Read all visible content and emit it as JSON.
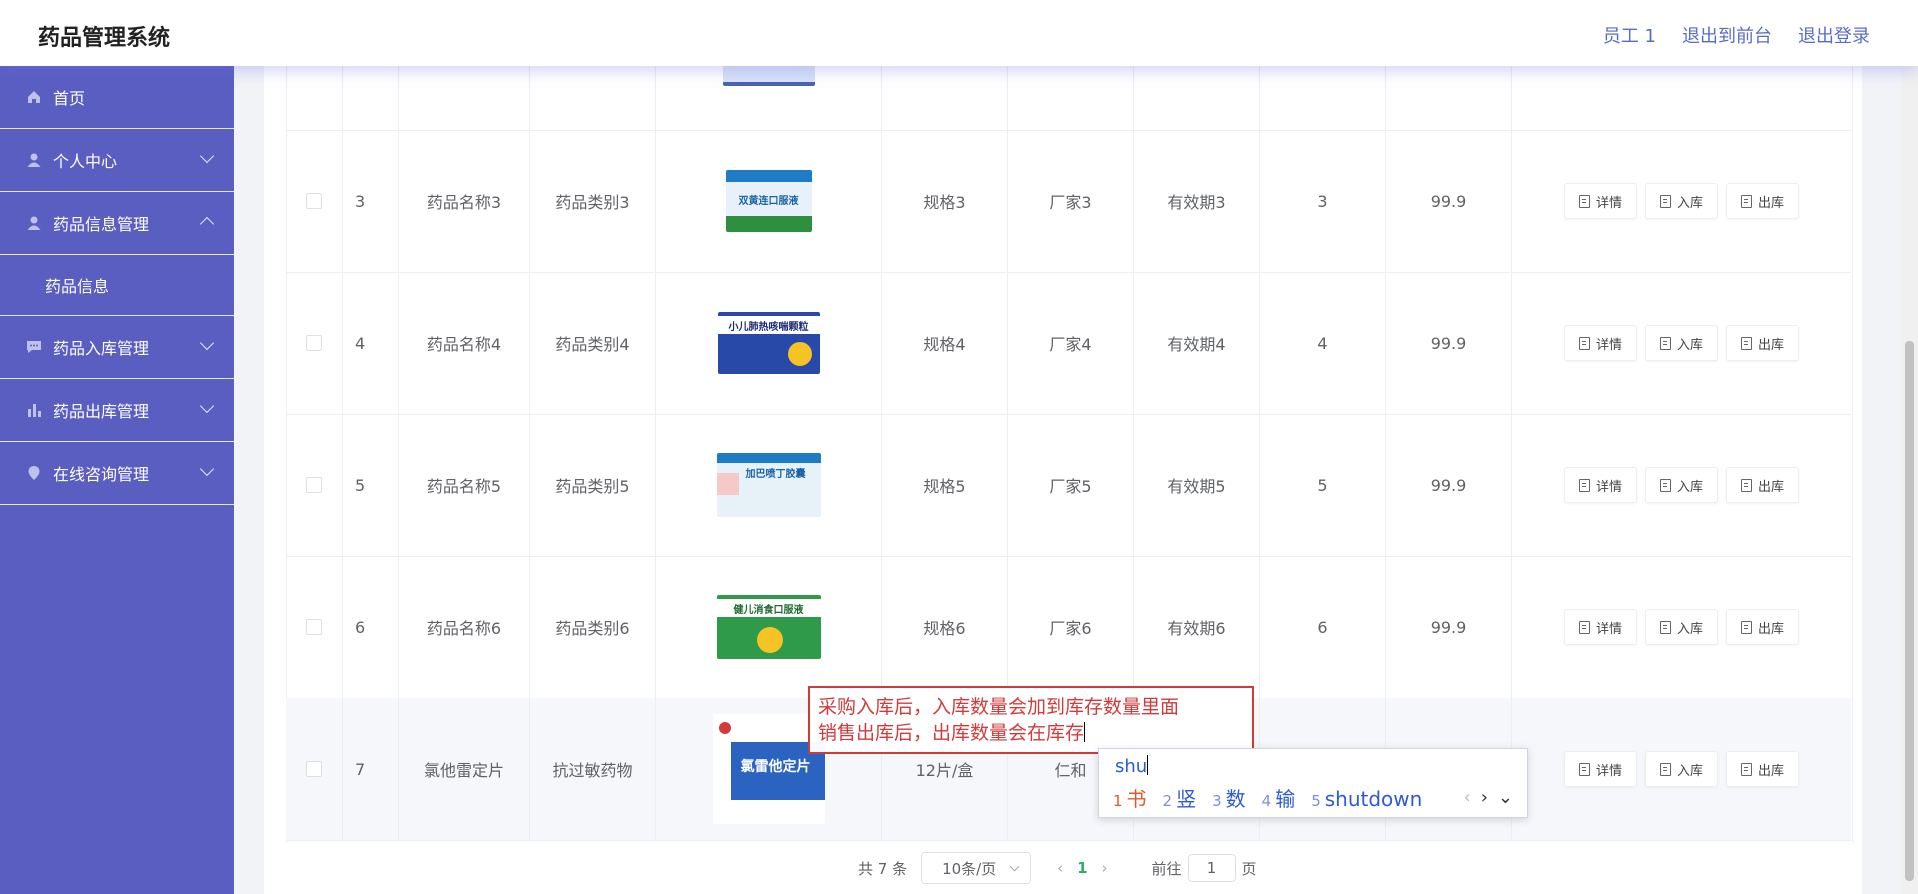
{
  "header": {
    "title": "药品管理系统",
    "links": [
      "员工 1",
      "退出到前台",
      "退出登录"
    ]
  },
  "sidebar": {
    "items": [
      {
        "label": "首页",
        "icon": "home-icon"
      },
      {
        "label": "个人中心",
        "icon": "user-icon"
      },
      {
        "label": "药品信息管理",
        "icon": "user-icon"
      },
      {
        "label": "药品信息"
      },
      {
        "label": "药品入库管理",
        "icon": "chat-icon"
      },
      {
        "label": "药品出库管理",
        "icon": "bar-chart-icon"
      },
      {
        "label": "在线咨询管理",
        "icon": "location-icon"
      }
    ]
  },
  "table": {
    "actions": {
      "detail": "详情",
      "stock_in": "入库",
      "stock_out": "出库"
    },
    "rows": [
      {
        "no": "3",
        "name": "药品名称3",
        "category": "药品类别3",
        "spec": "规格3",
        "maker": "厂家3",
        "expiry": "有效期3",
        "qty": "3",
        "price": "99.9",
        "image_label": "双黄连口服液"
      },
      {
        "no": "4",
        "name": "药品名称4",
        "category": "药品类别4",
        "spec": "规格4",
        "maker": "厂家4",
        "expiry": "有效期4",
        "qty": "4",
        "price": "99.9",
        "image_label": "小儿肺热咳喘颗粒"
      },
      {
        "no": "5",
        "name": "药品名称5",
        "category": "药品类别5",
        "spec": "规格5",
        "maker": "厂家5",
        "expiry": "有效期5",
        "qty": "5",
        "price": "99.9",
        "image_label": "加巴喷丁胶囊"
      },
      {
        "no": "6",
        "name": "药品名称6",
        "category": "药品类别6",
        "spec": "规格6",
        "maker": "厂家6",
        "expiry": "有效期6",
        "qty": "6",
        "price": "99.9",
        "image_label": "健儿消食口服液"
      },
      {
        "no": "7",
        "name": "氯他雷定片",
        "category": "抗过敏药物",
        "spec": "12片/盒",
        "maker": "仁和",
        "expiry": "",
        "qty": "",
        "price": "",
        "image_label": "氯雷他定片"
      }
    ]
  },
  "pagination": {
    "total": "共 7 条",
    "page_size": "10条/页",
    "current": "1",
    "goto_prefix": "前往",
    "goto_value": "1",
    "goto_suffix": "页"
  },
  "note": {
    "line1": "采购入库后，入库数量会加到库存数量里面",
    "line2": "销售出库后，出库数量会在库存"
  },
  "ime": {
    "composition": "shu",
    "candidates": [
      {
        "n": "1",
        "text": "书"
      },
      {
        "n": "2",
        "text": "竖"
      },
      {
        "n": "3",
        "text": "数"
      },
      {
        "n": "4",
        "text": "输"
      },
      {
        "n": "5",
        "text": "shutdown"
      }
    ],
    "controls": {
      "prev": "‹",
      "next": "›",
      "expand": "⌄"
    }
  },
  "colors": {
    "sidebar": "#5a5ec1",
    "header_link": "#5b6bc8",
    "note_border": "#cf3a3a",
    "pager_active": "#2fae6b"
  }
}
